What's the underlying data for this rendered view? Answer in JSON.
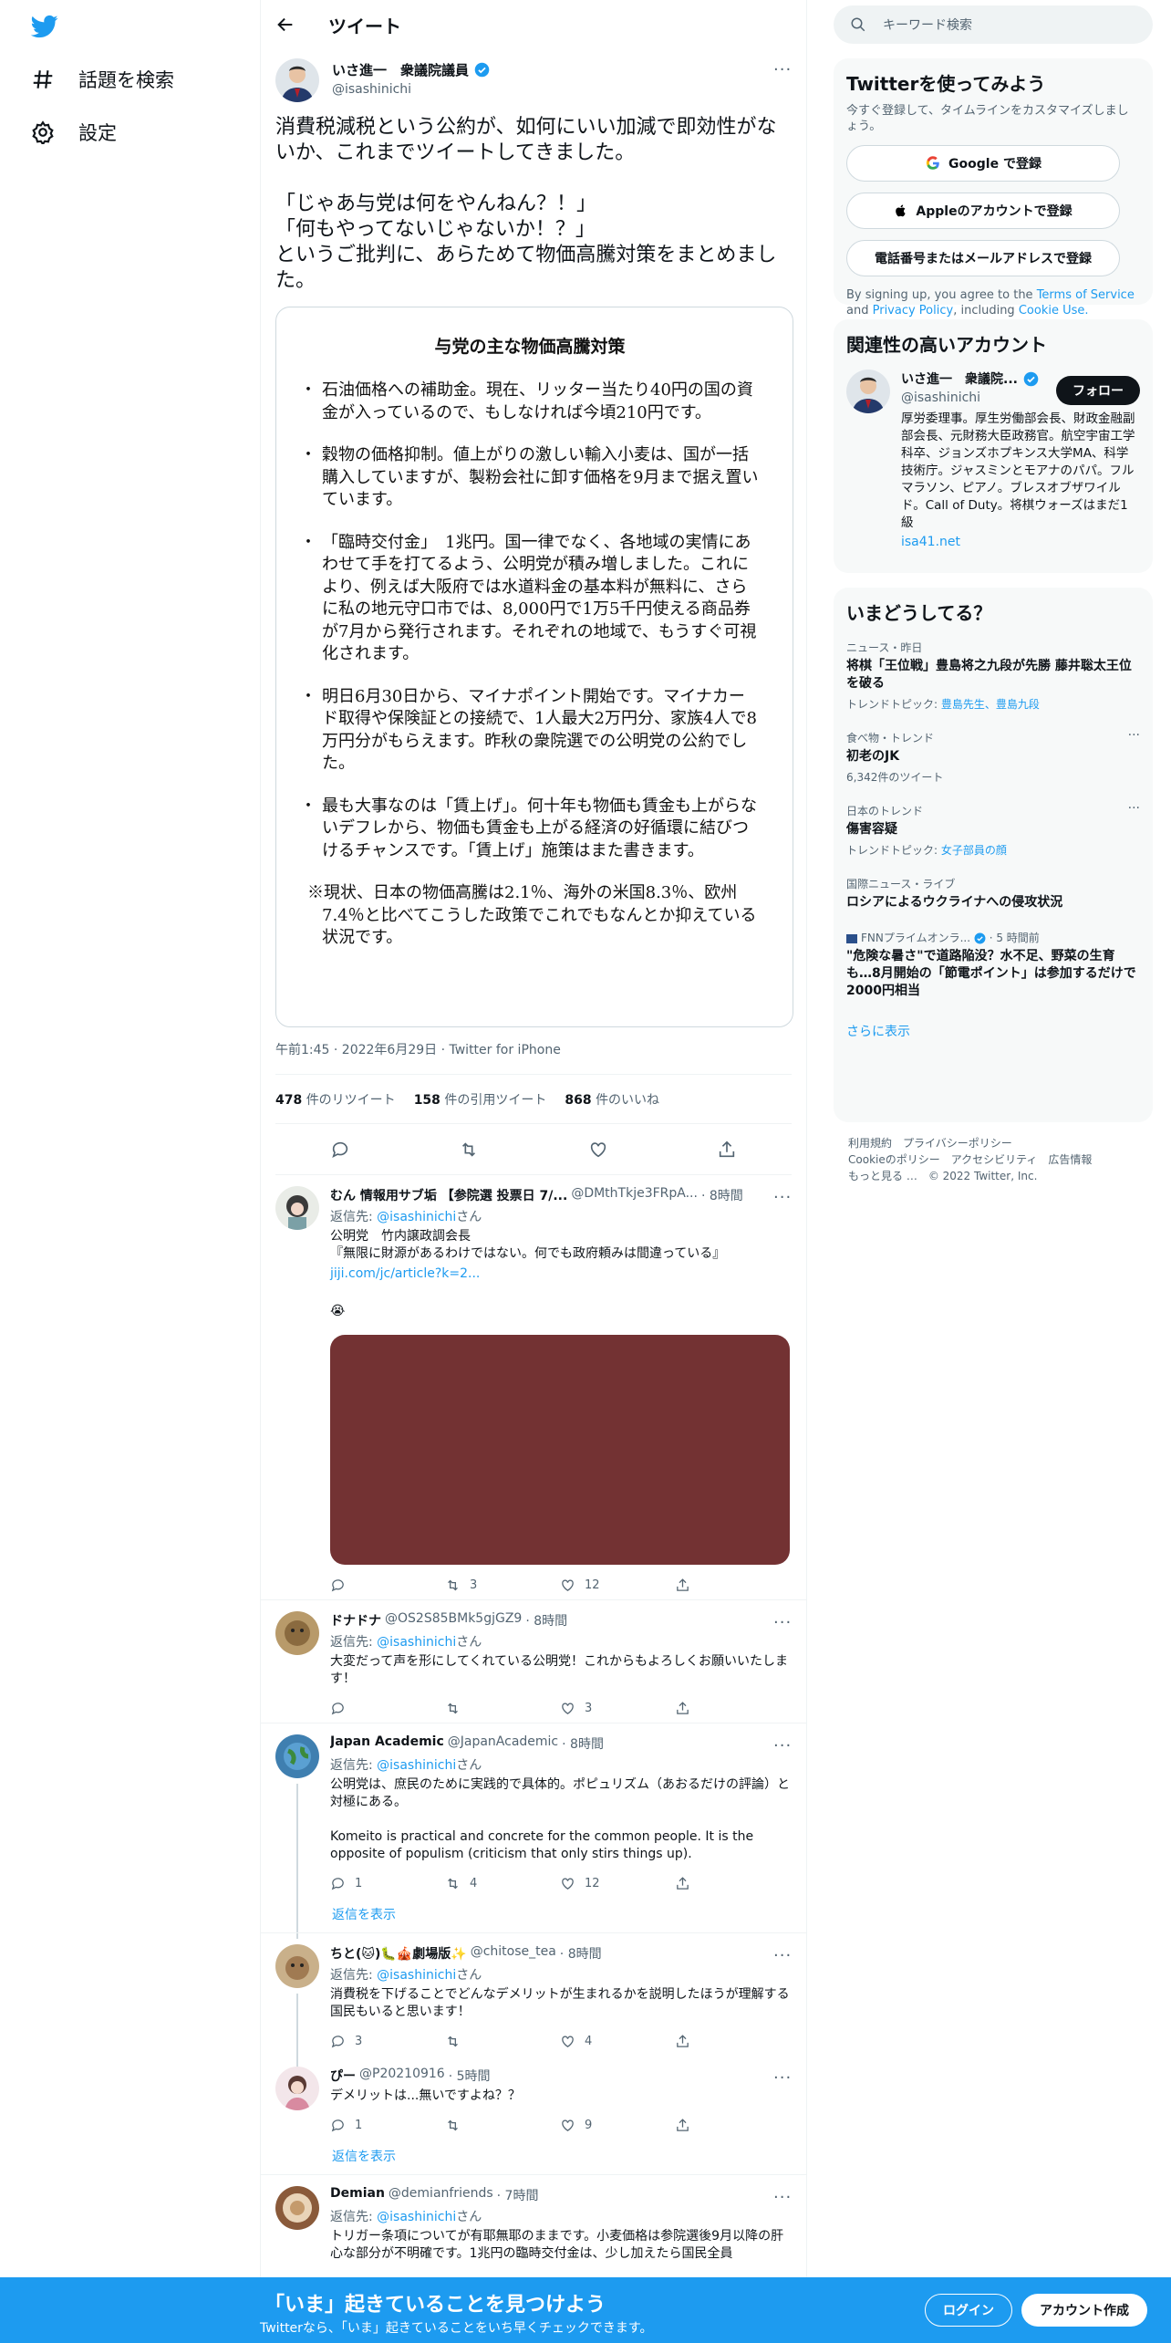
{
  "nav": {
    "explore": "話題を検索",
    "settings": "設定"
  },
  "header": {
    "title": "ツイート"
  },
  "tweet": {
    "name": "いさ進一　衆議院議員",
    "handle": "@isashinichi",
    "text": "消費税減税という公約が、如何にいい加減で即効性がないか、これまでツイートしてきました。\n\n「じゃあ与党は何をやんねん？！」\n「何もやってないじゃないか！？」\nというご批判に、あらためて物価高騰対策をまとめました。",
    "card": {
      "title": "与党の主な物価高騰対策",
      "bullets": [
        "石油価格への補助金。現在、リッター当たり40円の国の資金が入っているので、もしなければ今頃210円です。",
        "穀物の価格抑制。値上がりの激しい輸入小麦は、国が一括購入していますが、製粉会社に卸す価格を9月まで据え置いています。",
        "「臨時交付金」　1兆円。国一律でなく、各地域の実情にあわせて手を打てるよう、公明党が積み増しました。これにより、例えば大阪府では水道料金の基本料が無料に、さらに私の地元守口市では、8,000円で1万5千円使える商品券が7月から発行されます。それぞれの地域で、もうすぐ可視化されます。",
        "明日6月30日から、マイナポイント開始です。マイナカード取得や保険証との接続で、1人最大2万円分、家族4人で8万円分がもらえます。昨秋の衆院選での公明党の公約でした。",
        "最も大事なのは「賃上げ」。何十年も物価も賃金も上がらないデフレから、物価も賃金も上がる経済の好循環に結びつけるチャンスです。「賃上げ」施策はまた書きます。"
      ],
      "note": "※現状、日本の物価高騰は2.1％、海外の米国8.3％、欧州7.4％と比べてこうした政策でこれでもなんとか抑えている状況です。"
    },
    "meta": "午前1:45 · 2022年6月29日 · Twitter for iPhone",
    "retweets": "478",
    "retweets_label": "件のリツイート",
    "quotes": "158",
    "quotes_label": "件の引用ツイート",
    "likes": "868",
    "likes_label": "件のいいね"
  },
  "replying_to_label": "返信先:",
  "replying_to_handle": "@isashinichi",
  "replying_to_suffix": "さん",
  "show_replies": "返信を表示",
  "replies": [
    {
      "name": "むん 情報用サブ垢 【参院選 投票日 7/...",
      "handle": "@DMthTkje3FRpA...",
      "time": "· 8時間",
      "text": "公明党　竹内譲政調会長\n『無限に財源があるわけではない。何でも政府頼みは間違っている』",
      "link": "jiji.com/jc/article?k=2...",
      "emoji": "😭",
      "reply": "",
      "retweet": "3",
      "like": "12"
    },
    {
      "name": "ドナドナ",
      "handle": "@OS2S85BMk5gjGZ9",
      "time": "· 8時間",
      "text": "大変だって声を形にしてくれている公明党！これからもよろしくお願いいたします！",
      "reply": "",
      "retweet": "",
      "like": "3"
    },
    {
      "name": "Japan Academic",
      "handle": "@JapanAcademic",
      "time": "· 8時間",
      "text": "公明党は、庶民のために実践的で具体的。ポピュリズム（あおるだけの評論）と対極にある。\n\nKomeito is practical and concrete for the common people. It is the opposite of populism (criticism that only stirs things up).",
      "reply": "1",
      "retweet": "4",
      "like": "12"
    },
    {
      "name": "ちと(🐱)🐛🎪劇場版✨",
      "handle": "@chitose_tea",
      "time": "· 8時間",
      "text": "消費税を下げることでどんなデメリットが生まれるかを説明したほうが理解する国民もいると思います！",
      "reply": "3",
      "retweet": "",
      "like": "4"
    },
    {
      "name": "ぴー",
      "handle": "@P20210916",
      "time": "· 5時間",
      "text": "デメリットは...無いですよね？？",
      "reply": "1",
      "retweet": "",
      "like": "9"
    },
    {
      "name": "Demian",
      "handle": "@demianfriends",
      "time": "· 7時間",
      "text": "トリガー条項についてが有耶無耶のままです。小麦価格は参院選後9月以降の肝心な部分が不明確です。1兆円の臨時交付金は、少し加えたら国民全員",
      "reply": "",
      "retweet": "",
      "like": ""
    }
  ],
  "right": {
    "search_placeholder": "キーワード検索",
    "signup": {
      "title": "Twitterを使ってみよう",
      "sub": "今すぐ登録して、タイムラインをカスタマイズしましょう。",
      "google": "Google で登録",
      "apple": "Appleのアカウントで登録",
      "phone": "電話番号またはメールアドレスで登録",
      "terms_a": "By signing up, you agree to the",
      "terms_link1": "Terms of Service",
      "terms_and": "and",
      "terms_link2": "Privacy Policy",
      "terms_incl": ", including",
      "terms_link3": "Cookie Use."
    },
    "related": {
      "title": "関連性の高いアカウント",
      "name": "いさ進一　衆議院...",
      "handle": "@isashinichi",
      "follow": "フォロー",
      "bio": "厚労委理事。厚生労働部会長、財政金融副部会長、元財務大臣政務官。航空宇宙工学科卒、ジョンズホプキンス大学MA、科学技術庁。ジャスミンとモアナのパパ。フルマラソン、ピアノ。ブレスオブザワイルド。Call of Duty。将棋ウォーズはまだ1級",
      "link": "isa41.net"
    },
    "trends_title": "いまどうしてる？",
    "trends": [
      {
        "cat": "ニュース・昨日",
        "name": "将棋「王位戦」豊島将之九段が先勝 藤井聡太王位を破る",
        "sub_label": "トレンドトピック: ",
        "sub_links": "豊島先生、豊島九段",
        "sub": ""
      },
      {
        "cat": "食べ物・トレンド",
        "name": "初老のJK",
        "sub_label": "",
        "sub_links": "",
        "sub": "6,342件のツイート"
      },
      {
        "cat": "日本のトレンド",
        "name": "傷害容疑",
        "sub_label": "トレンドトピック: ",
        "sub_links": "女子部員の顔",
        "sub": ""
      },
      {
        "cat": "国際ニュース・ライブ",
        "name": "ロシアによるウクライナへの侵攻状況",
        "sub_label": "",
        "sub_links": "",
        "sub": ""
      },
      {
        "cat": "FNNプライムオンラ...",
        "time": "· 5 時間前",
        "name": "\"危険な暑さ\"で道路陥没？水不足、野菜の生育も…8月開始の「節電ポイント」は参加するだけで2000円相当",
        "sub_label": "",
        "sub_links": "",
        "sub": ""
      }
    ],
    "show_more": "さらに表示",
    "footer_line1": "利用規約　プライバシーポリシー",
    "footer_line2": "Cookieのポリシー　アクセシビリティ　広告情報",
    "footer_line3": "もっと見る …　© 2022 Twitter, Inc."
  },
  "bottom": {
    "title": "「いま」起きていることを見つけよう",
    "sub": "Twitterなら、「いま」起きていることをいち早くチェックできます。",
    "login": "ログイン",
    "signup": "アカウント作成"
  },
  "colors": {
    "accent": "#1d9bf0",
    "media": "#733233"
  }
}
